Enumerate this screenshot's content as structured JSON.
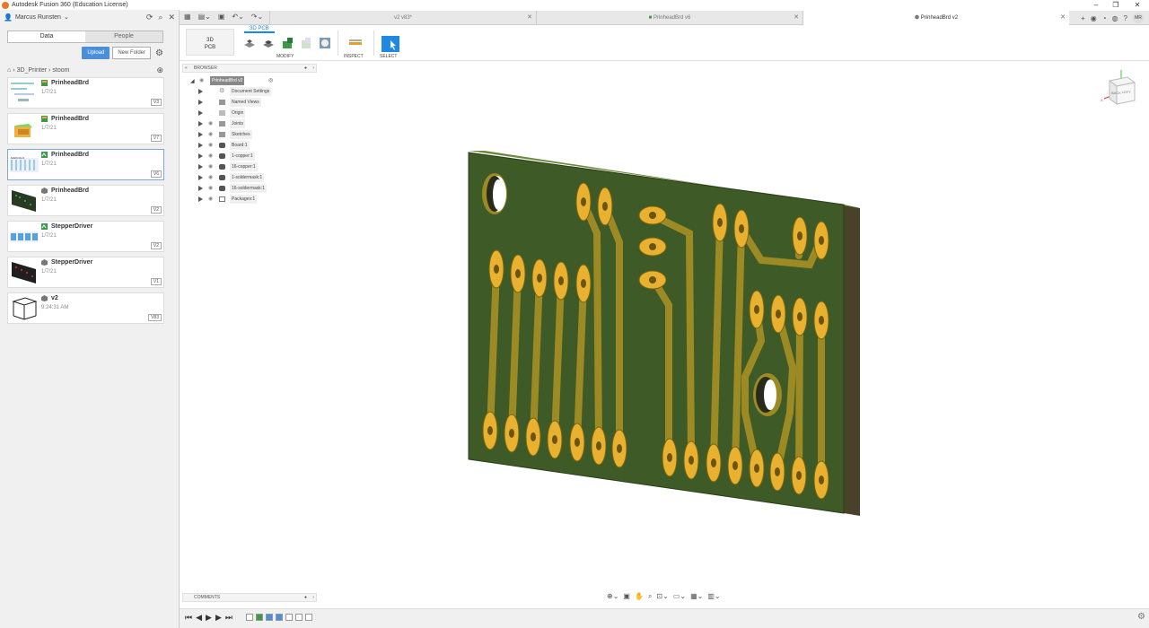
{
  "app": {
    "title": "Autodesk Fusion 360 (Education License)"
  },
  "data_panel": {
    "user": "Marcus Runsten",
    "tabs": [
      "Data",
      "People"
    ],
    "upload": "Upload",
    "new_folder": "New Folder",
    "breadcrumb": [
      "3D_Printer",
      "stoom"
    ],
    "files": [
      {
        "name": "PrinheadBrd",
        "date": "1/7/21",
        "version": "V3",
        "type": "board"
      },
      {
        "name": "PrinheadBrd",
        "date": "1/7/21",
        "version": "V7",
        "type": "board"
      },
      {
        "name": "PrinheadBrd",
        "date": "1/7/21",
        "version": "V6",
        "type": "schematic"
      },
      {
        "name": "PrinheadBrd",
        "date": "1/7/21",
        "version": "V2",
        "type": "3d"
      },
      {
        "name": "StepperDriver",
        "date": "1/7/21",
        "version": "V2",
        "type": "schematic"
      },
      {
        "name": "StepperDriver",
        "date": "1/7/21",
        "version": "V1",
        "type": "3d"
      },
      {
        "name": "v2",
        "date": "9:24:31 AM",
        "version": "V83",
        "type": "3d"
      }
    ]
  },
  "tabs": [
    {
      "label": "v2 v83*"
    },
    {
      "label": "PrinheadBrd v6"
    },
    {
      "label": "PrinheadBrd v2"
    }
  ],
  "user_initials": "MR",
  "toolbar": {
    "workspace_top": "3D",
    "workspace_bottom": "PCB",
    "workspace_tab": "3D PCB",
    "modify": "MODIFY",
    "inspect": "INSPECT",
    "select": "SELECT"
  },
  "browser": {
    "title": "BROWSER",
    "root": "PrinheadBrd v2",
    "nodes": [
      "Document Settings",
      "Named Views",
      "Origin",
      "Joints",
      "Sketches",
      "Board:1",
      "1-copper:1",
      "16-copper:1",
      "1-soldermask:1",
      "16-soldermask:1",
      "Packages:1"
    ]
  },
  "comments": "COMMENTS",
  "viewcube": {
    "front": "BACK",
    "side": "LEFT"
  },
  "colors": {
    "board": "#3e5a26",
    "pad": "#e8b12f",
    "trace": "#9c8a25",
    "accent": "#1e88e5"
  }
}
